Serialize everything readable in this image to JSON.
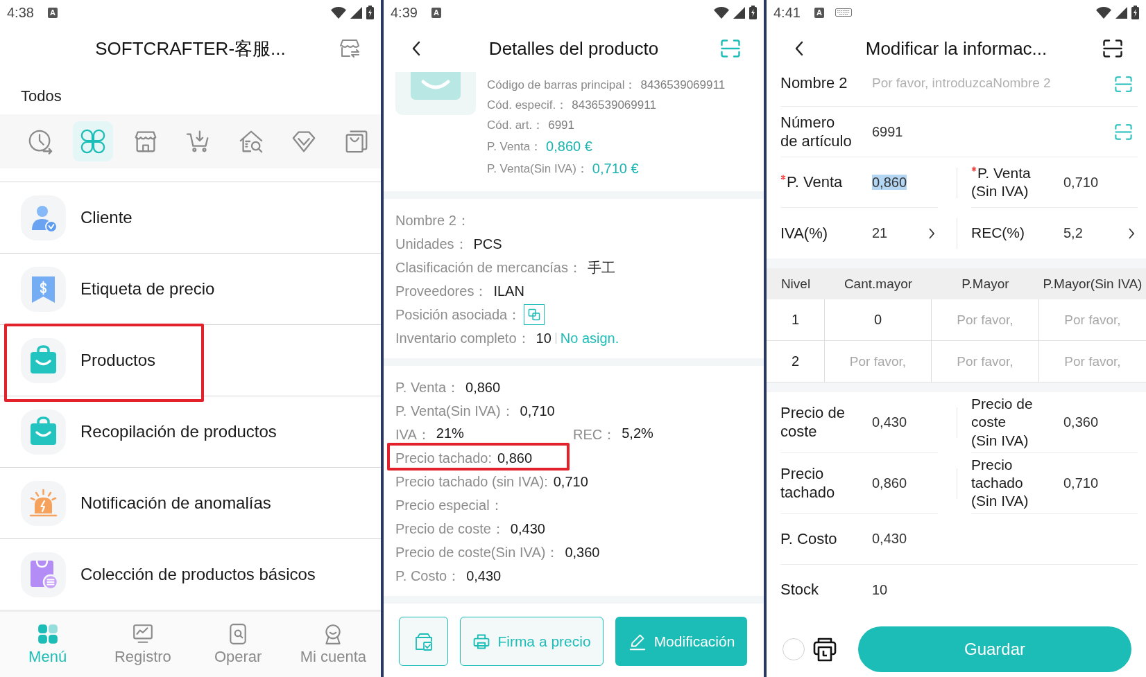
{
  "screens": [
    {
      "kind": "menu",
      "status_bar": {
        "time": "4:38",
        "badge": "A",
        "input_method_active": false
      },
      "header": {
        "title": "SOFTCRAFTER-客服...",
        "back": false
      },
      "section_title": "Todos",
      "category_icons": [
        {
          "selected": false
        },
        {
          "selected": true
        },
        {
          "selected": false
        },
        {
          "selected": false
        },
        {
          "selected": false
        },
        {
          "selected": false
        },
        {
          "selected": false
        }
      ],
      "menu_items": [
        {
          "label": "Cliente",
          "highlighted": false
        },
        {
          "label": "Etiqueta de precio",
          "highlighted": false
        },
        {
          "label": "Productos",
          "highlighted": true
        },
        {
          "label": "Recopilación de productos",
          "highlighted": false
        },
        {
          "label": "Notificación de anomalías",
          "highlighted": false
        },
        {
          "label": "Colección de productos básicos",
          "highlighted": false
        }
      ],
      "bottom_nav": [
        {
          "label": "Menú",
          "selected": true
        },
        {
          "label": "Registro",
          "selected": false
        },
        {
          "label": "Operar",
          "selected": false
        },
        {
          "label": "Mi cuenta",
          "selected": false
        }
      ]
    },
    {
      "kind": "detail",
      "status_bar": {
        "time": "4:39",
        "badge": "A",
        "input_method_active": false
      },
      "header": {
        "title": "Detalles del producto",
        "back": true
      },
      "summary": [
        {
          "label": "Código de barras principal：",
          "value": "8436539069911",
          "kind": "code"
        },
        {
          "label": "Cód. especif.：",
          "value": "8436539069911",
          "kind": "code"
        },
        {
          "label": "Cód. art.：",
          "value": "6991",
          "kind": "code"
        },
        {
          "label": "P. Venta：",
          "value": "0,860 €",
          "kind": "price"
        },
        {
          "label": "P. Venta(Sin IVA)：",
          "value": "0,710 €",
          "kind": "price"
        }
      ],
      "sections": [
        {
          "rows": [
            {
              "kind": "text",
              "label": "Nombre 2：",
              "highlighted": false
            },
            {
              "kind": "text",
              "label": "Unidades：",
              "value": "PCS",
              "highlighted": false
            },
            {
              "kind": "text",
              "label": "Clasificación de mercancías：",
              "value": "手工",
              "highlighted": false
            },
            {
              "kind": "text",
              "label": "Proveedores：",
              "value": "ILAN",
              "highlighted": false
            },
            {
              "kind": "button",
              "label": "Posición asociada：",
              "highlighted": false
            },
            {
              "kind": "stock",
              "label": "Inventario completo：",
              "value": "10",
              "link": "No asign.",
              "highlighted": false
            }
          ]
        },
        {
          "rows": [
            {
              "kind": "text",
              "label": "P. Venta：",
              "value": "0,860",
              "highlighted": false
            },
            {
              "kind": "text",
              "label": "P. Venta(Sin IVA)：",
              "value": "0,710",
              "highlighted": false
            },
            {
              "kind": "pair",
              "items": [
                {
                  "label": "IVA：",
                  "value": "21%"
                },
                {
                  "label": "REC：",
                  "value": "5,2%"
                }
              ],
              "highlighted": false
            },
            {
              "kind": "text",
              "label": "Precio tachado:",
              "value": "0,860",
              "highlighted": true
            },
            {
              "kind": "text",
              "label": "Precio tachado (sin IVA):",
              "value": "0,710",
              "highlighted": false
            },
            {
              "kind": "text",
              "label": "Precio especial：",
              "highlighted": false
            },
            {
              "kind": "text",
              "label": "Precio de coste：",
              "value": "0,430",
              "highlighted": false
            },
            {
              "kind": "text",
              "label": "Precio de coste(Sin IVA)：",
              "value": "0,360",
              "highlighted": false
            },
            {
              "kind": "text",
              "label": "P. Costo：",
              "value": "0,430",
              "highlighted": false
            }
          ]
        }
      ],
      "actions": [
        {
          "kind": "icon"
        },
        {
          "kind": "outline",
          "label": "Firma a precio"
        },
        {
          "kind": "filled",
          "label": "Modificación"
        }
      ]
    },
    {
      "kind": "edit",
      "status_bar": {
        "time": "4:41",
        "badge": "A",
        "input_method_active": true
      },
      "header": {
        "title": "Modificar la informac...",
        "back": true
      },
      "form_groups": [
        {
          "rows": [
            {
              "kind": "single",
              "label": "Nombre 2",
              "placeholder": "Por favor, introduzcaNombre 2",
              "scan": true
            },
            {
              "kind": "single",
              "label": "Número de artículo",
              "value": "6991",
              "text_selected": false,
              "scan": true
            },
            {
              "kind": "pair",
              "cells": [
                {
                  "label": "P. Venta",
                  "value": "0,860",
                  "required": true,
                  "text_selected": true,
                  "chevron": false
                },
                {
                  "label": "P. Venta (Sin IVA)",
                  "value": "0,710",
                  "required": true,
                  "text_selected": false,
                  "chevron": false
                }
              ]
            },
            {
              "kind": "pair",
              "cells": [
                {
                  "label": "IVA(%)",
                  "value": "21",
                  "required": false,
                  "text_selected": false,
                  "chevron": true
                },
                {
                  "label": "REC(%)",
                  "value": "5,2",
                  "required": false,
                  "text_selected": false,
                  "chevron": true
                }
              ]
            }
          ]
        },
        {
          "rows": [
            {
              "kind": "pair",
              "cells": [
                {
                  "label": "Precio de coste",
                  "value": "0,430",
                  "required": false,
                  "text_selected": false,
                  "chevron": false
                },
                {
                  "label": "Precio de coste (Sin IVA)",
                  "value": "0,360",
                  "required": false,
                  "text_selected": false,
                  "chevron": false
                }
              ]
            },
            {
              "kind": "pair",
              "cells": [
                {
                  "label": "Precio tachado",
                  "value": "0,860",
                  "required": false,
                  "text_selected": false,
                  "chevron": false
                },
                {
                  "label": "Precio tachado (Sin IVA)",
                  "value": "0,710",
                  "required": false,
                  "text_selected": false,
                  "chevron": false
                }
              ]
            },
            {
              "kind": "single",
              "label": "P. Costo",
              "value": "0,430",
              "text_selected": false,
              "scan": false
            },
            {
              "kind": "single",
              "label": "Stock",
              "value": "10",
              "text_selected": false,
              "scan": false
            }
          ]
        }
      ],
      "wholesale_table": {
        "columns": [
          "Nivel",
          "Cant.mayor",
          "P.Mayor",
          "P.Mayor(Sin IVA)"
        ],
        "rows": [
          {
            "tier": "1",
            "fields": [
              {
                "value": "0"
              },
              {
                "placeholder": "Por favor,"
              },
              {
                "placeholder": "Por favor,"
              }
            ]
          },
          {
            "tier": "2",
            "fields": [
              {
                "placeholder": "Por favor,"
              },
              {
                "placeholder": "Por favor,"
              },
              {
                "placeholder": "Por favor,"
              }
            ]
          }
        ]
      },
      "footer": {
        "checked": false,
        "save_label": "Guardar"
      }
    }
  ]
}
